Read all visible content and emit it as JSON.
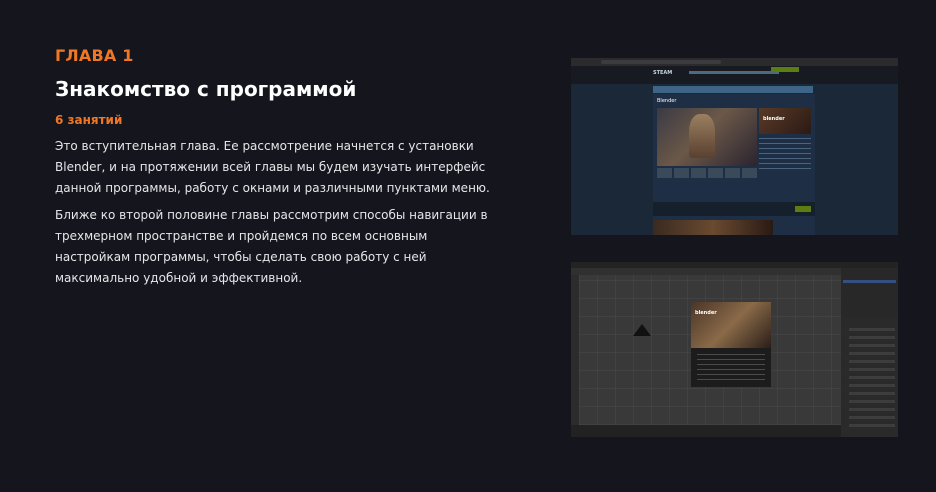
{
  "chapter": {
    "label": "ГЛАВА 1",
    "title": "Знакомство с программой",
    "lessons": "6 занятий",
    "paragraphs": [
      "Это вступительная глава. Ее рассмотрение начнется с установки Blender, и на протяжении всей главы мы будем изучать интерфейс данной программы, работу с окнами и различными пунктами меню.",
      "Ближе ко второй половине главы рассмотрим способы навигации в трехмерном пространстве и пройдемся по всем основным настройкам программы, чтобы сделать свою работу с ней максимально удобной и эффективной."
    ]
  },
  "screenshots": {
    "steam": {
      "logo_text": "STEAM",
      "game_title": "Blender",
      "side_logo_text": "blender"
    },
    "blender": {
      "splash_logo_text": "blender"
    }
  },
  "colors": {
    "accent": "#f07824",
    "background": "#15151d",
    "heading": "#ffffff",
    "body_text": "#e6e6ea"
  }
}
